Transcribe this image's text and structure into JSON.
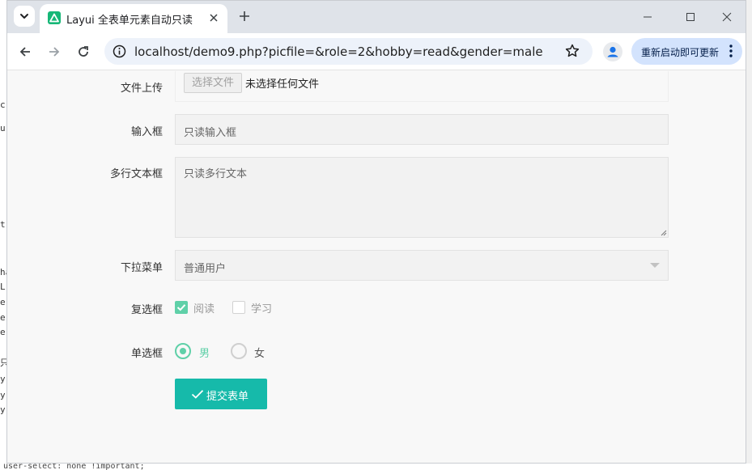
{
  "background": {
    "left_code_fragments": [
      "cr",
      "u",
      "t",
      "ha",
      "L",
      "e",
      "e",
      "e",
      "只",
      "y",
      "y",
      "y"
    ],
    "bottom_code": "user-select: none !important;"
  },
  "browser": {
    "tab_title": "Layui 全表单元素自动只读",
    "url": "localhost/demo9.php?picfile=&role=2&hobby=read&gender=male",
    "update_label": "重新启动即可更新",
    "favicon_color": "#16b777"
  },
  "form": {
    "file": {
      "label": "文件上传",
      "button": "选择文件",
      "status": "未选择任何文件"
    },
    "input": {
      "label": "输入框",
      "value": "只读输入框"
    },
    "textarea": {
      "label": "多行文本框",
      "value": "只读多行文本"
    },
    "select": {
      "label": "下拉菜单",
      "value": "普通用户"
    },
    "checkbox": {
      "label": "复选框",
      "options": [
        {
          "text": "阅读",
          "checked": true
        },
        {
          "text": "学习",
          "checked": false
        }
      ]
    },
    "radio": {
      "label": "单选框",
      "options": [
        {
          "text": "男",
          "checked": true
        },
        {
          "text": "女",
          "checked": false
        }
      ]
    },
    "submit": {
      "label": "提交表单",
      "color": "#16baaa"
    }
  },
  "colors": {
    "accent": "#5fd0a8",
    "primary": "#16baaa"
  }
}
